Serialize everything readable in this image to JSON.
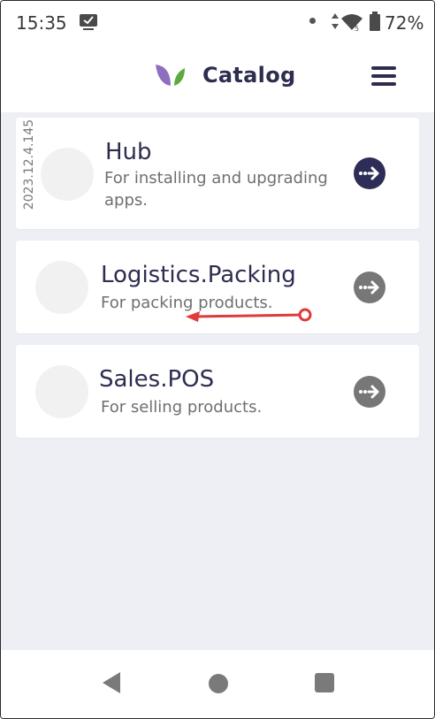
{
  "status_bar": {
    "time": "15:35",
    "battery_percent": "72%"
  },
  "header": {
    "title": "Catalog",
    "logo_colors": {
      "left_leaf": "#8e6fbf",
      "right_leaf": "#5aab3c"
    }
  },
  "catalog": {
    "items": [
      {
        "name": "Hub",
        "description": "For installing and upgrading apps.",
        "version": "2023.12.4.145",
        "button_color": "#2d2d57"
      },
      {
        "name": "Logistics.Packing",
        "description": "For packing products.",
        "button_color": "#777777"
      },
      {
        "name": "Sales.POS",
        "description": "For selling products.",
        "button_color": "#777777"
      }
    ]
  },
  "annotation": {
    "type": "swipe-left-arrow",
    "color": "#e03a3a"
  },
  "nav_bar": {
    "icons": [
      "back-icon",
      "home-icon",
      "recents-icon"
    ]
  }
}
